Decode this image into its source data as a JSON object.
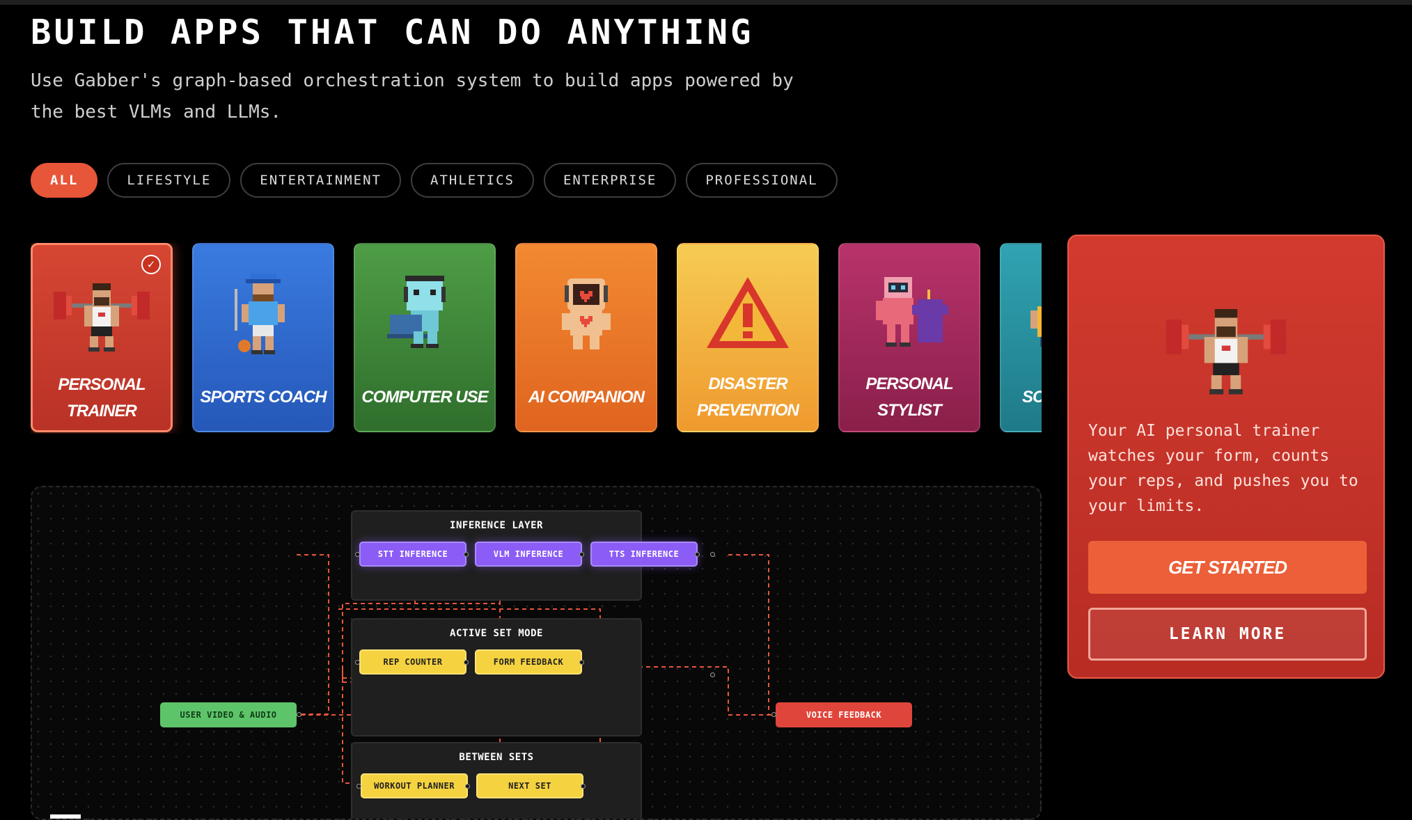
{
  "hero": {
    "title": "BUILD APPS THAT CAN DO ANYTHING",
    "subtitle": "Use Gabber's graph-based orchestration system to build apps powered by the best VLMs and LLMs."
  },
  "filters": [
    {
      "label": "ALL",
      "active": true
    },
    {
      "label": "LIFESTYLE",
      "active": false
    },
    {
      "label": "ENTERTAINMENT",
      "active": false
    },
    {
      "label": "ATHLETICS",
      "active": false
    },
    {
      "label": "ENTERPRISE",
      "active": false
    },
    {
      "label": "PROFESSIONAL",
      "active": false
    }
  ],
  "cards": [
    {
      "label": "PERSONAL TRAINER",
      "icon": "weightlifter-icon",
      "color": "#d4402f",
      "selected": true
    },
    {
      "label": "SPORTS COACH",
      "icon": "coach-icon",
      "color": "#2f6fd6"
    },
    {
      "label": "COMPUTER USE",
      "icon": "robot-laptop-icon",
      "color": "#3f8f3c"
    },
    {
      "label": "AI COMPANION",
      "icon": "robot-heart-icon",
      "color": "#ef7d2a"
    },
    {
      "label": "DISASTER PREVENTION",
      "icon": "warning-icon",
      "color": "#f5b23a"
    },
    {
      "label": "PERSONAL STYLIST",
      "icon": "robot-stylist-icon",
      "color": "#a52b5c"
    },
    {
      "label": "SCR",
      "icon": "person-icon",
      "color": "#2b9aa8"
    }
  ],
  "detail": {
    "description": "Your AI personal trainer watches your form, counts your reps, and pushes you to your limits.",
    "primary_button": "GET STARTED",
    "secondary_button": "LEARN MORE"
  },
  "graph": {
    "groups": [
      {
        "title": "INFERENCE LAYER",
        "nodes": [
          "STT INFERENCE",
          "VLM INFERENCE",
          "TTS INFERENCE"
        ]
      },
      {
        "title": "ACTIVE SET MODE",
        "nodes": [
          "REP COUNTER",
          "FORM FEEDBACK"
        ]
      },
      {
        "title": "BETWEEN SETS",
        "nodes": [
          "WORKOUT PLANNER",
          "NEXT SET"
        ]
      }
    ],
    "input_node": "USER VIDEO & AUDIO",
    "output_node": "VOICE FEEDBACK"
  },
  "colors": {
    "accent": "#e8563a",
    "node_purple": "#8b5cf6",
    "node_yellow": "#f5d23f",
    "node_green": "#5ec46a",
    "node_red": "#e0453b",
    "wire": "#e8563a"
  }
}
